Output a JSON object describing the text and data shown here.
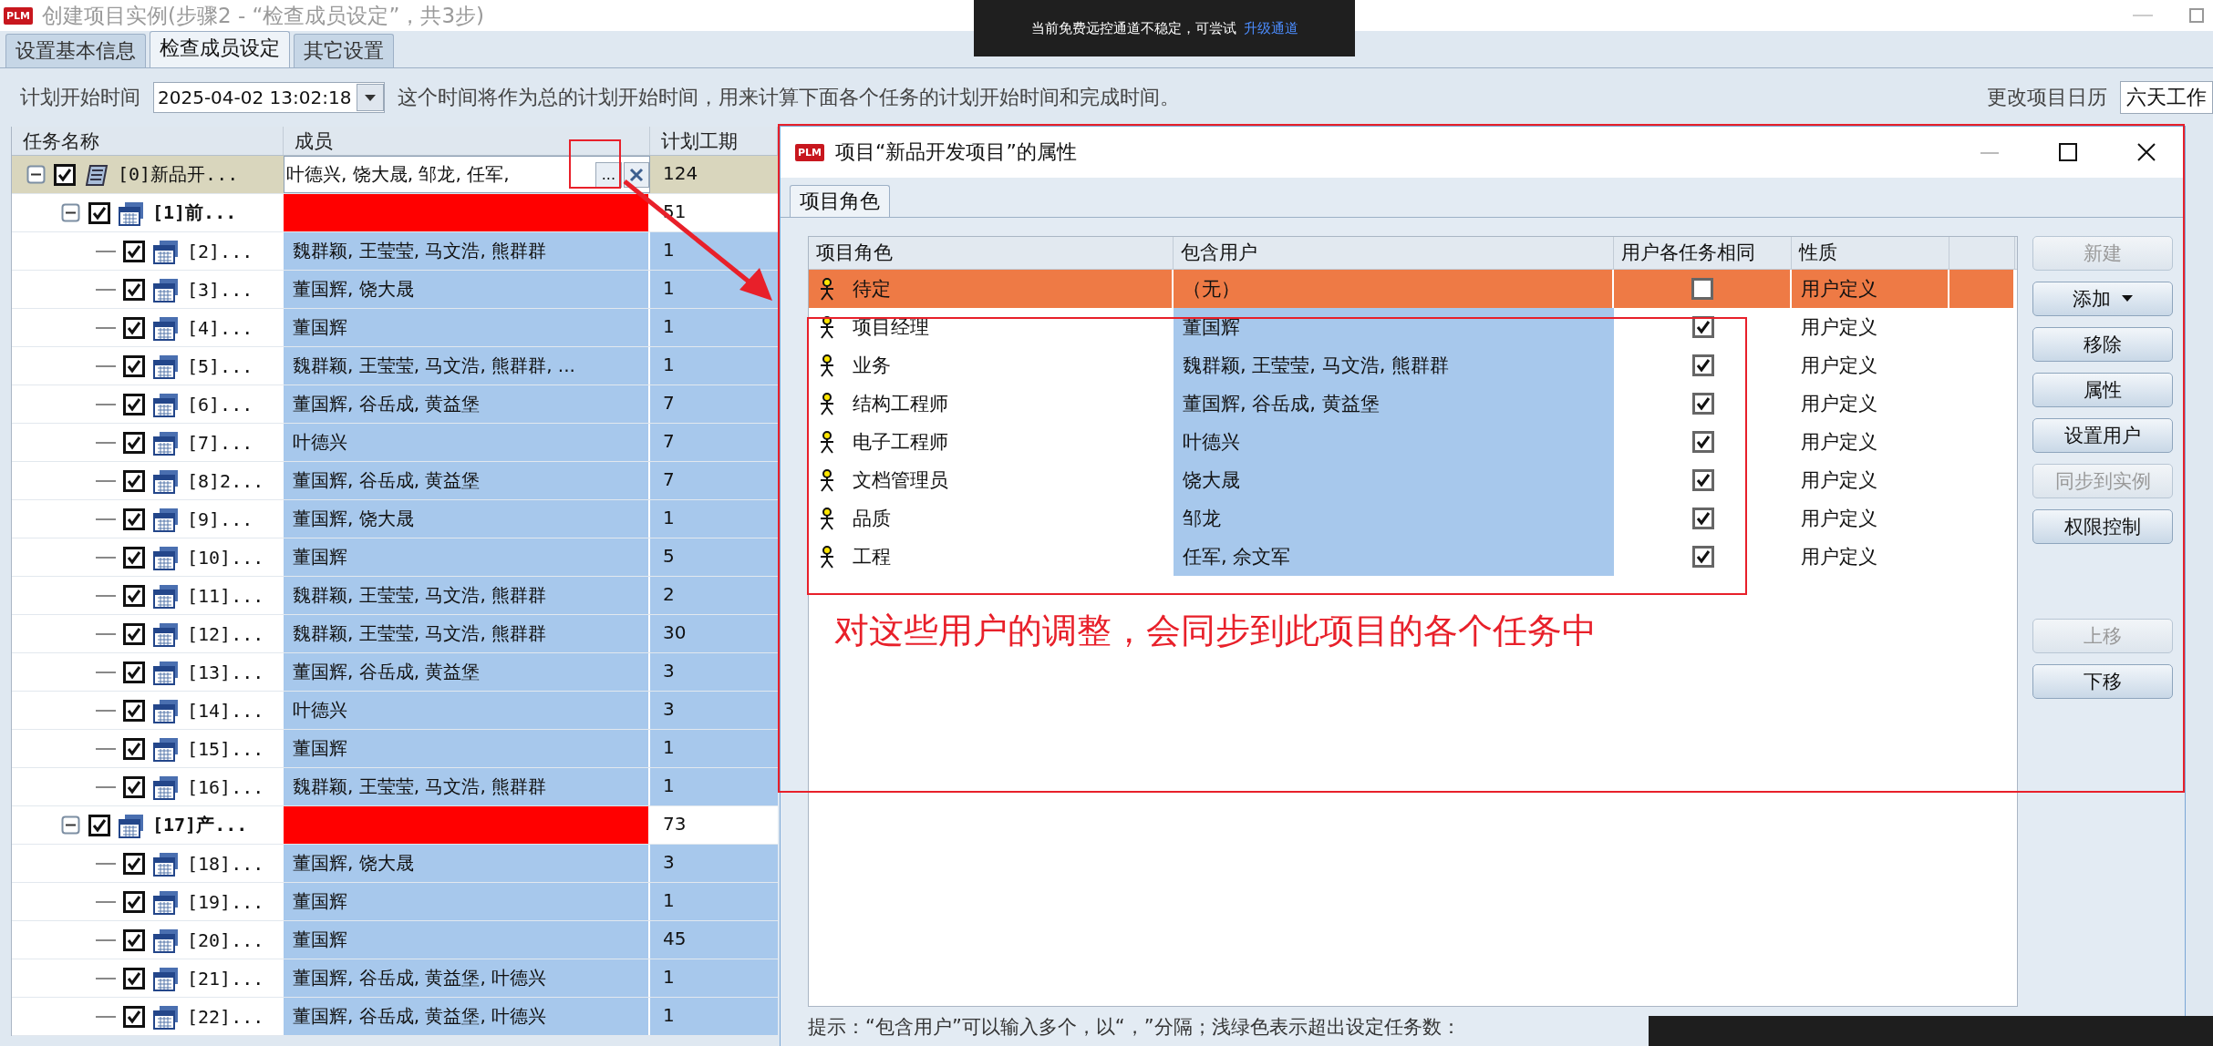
{
  "window": {
    "logo": "PLM",
    "title": "创建项目实例(步骤2 - “检查成员设定”，共3步)"
  },
  "notification": {
    "text": "当前免费远控通道不稳定，可尝试",
    "link": "升级通道"
  },
  "tabs": [
    {
      "label": "设置基本信息",
      "selected": false
    },
    {
      "label": "检查成员设定",
      "selected": true
    },
    {
      "label": "其它设置",
      "selected": false
    }
  ],
  "toolbar": {
    "start_label": "计划开始时间",
    "start_value": "2025-04-02 13:02:18",
    "note": "这个时间将作为总的计划开始时间，用来计算下面各个任务的计划开始时间和完成时间。",
    "calendar_label": "更改项目日历",
    "calendar_value": "六天工作"
  },
  "task_table": {
    "columns": [
      "任务名称",
      "成员",
      "计划工期"
    ],
    "browse_label": "...",
    "rows": [
      {
        "kind": "project",
        "name": "[0]新品开...",
        "members": "叶德兴, 饶大晟, 邹龙, 任军,",
        "duration": "124",
        "checked": true,
        "expanded": true,
        "selected": true,
        "flagged": false,
        "children": [
          {
            "kind": "phase",
            "name": "[1]前...",
            "duration": "51",
            "checked": true,
            "expanded": true,
            "selected": false,
            "flagged": true,
            "children": [
              {
                "kind": "task",
                "name": "[2]...",
                "members": "魏群颖, 王莹莹, 马文浩, 熊群群",
                "duration": "1",
                "checked": true,
                "selected": false,
                "flagged": false
              },
              {
                "kind": "task",
                "name": "[3]...",
                "members": "董国辉, 饶大晟",
                "duration": "1",
                "checked": true,
                "selected": false,
                "flagged": false
              },
              {
                "kind": "task",
                "name": "[4]...",
                "members": "董国辉",
                "duration": "1",
                "checked": true,
                "selected": false,
                "flagged": false
              },
              {
                "kind": "task",
                "name": "[5]...",
                "members": "魏群颖, 王莹莹, 马文浩, 熊群群, ...",
                "duration": "1",
                "checked": true,
                "selected": false,
                "flagged": false
              },
              {
                "kind": "task",
                "name": "[6]...",
                "members": "董国辉, 谷岳成, 黄益堡",
                "duration": "7",
                "checked": true,
                "selected": false,
                "flagged": false
              },
              {
                "kind": "task",
                "name": "[7]...",
                "members": "叶德兴",
                "duration": "7",
                "checked": true,
                "selected": false,
                "flagged": false
              },
              {
                "kind": "task",
                "name": "[8]2...",
                "members": "董国辉, 谷岳成, 黄益堡",
                "duration": "7",
                "checked": true,
                "selected": false,
                "flagged": false
              },
              {
                "kind": "task",
                "name": "[9]...",
                "members": "董国辉, 饶大晟",
                "duration": "1",
                "checked": true,
                "selected": false,
                "flagged": false
              },
              {
                "kind": "task",
                "name": "[10]...",
                "members": "董国辉",
                "duration": "5",
                "checked": true,
                "selected": false,
                "flagged": false
              },
              {
                "kind": "task",
                "name": "[11]...",
                "members": "魏群颖, 王莹莹, 马文浩, 熊群群",
                "duration": "2",
                "checked": true,
                "selected": false,
                "flagged": false
              },
              {
                "kind": "task",
                "name": "[12]...",
                "members": "魏群颖, 王莹莹, 马文浩, 熊群群",
                "duration": "30",
                "checked": true,
                "selected": false,
                "flagged": false
              },
              {
                "kind": "task",
                "name": "[13]...",
                "members": "董国辉, 谷岳成, 黄益堡",
                "duration": "3",
                "checked": true,
                "selected": false,
                "flagged": false
              },
              {
                "kind": "task",
                "name": "[14]...",
                "members": "叶德兴",
                "duration": "3",
                "checked": true,
                "selected": false,
                "flagged": false
              },
              {
                "kind": "task",
                "name": "[15]...",
                "members": "董国辉",
                "duration": "1",
                "checked": true,
                "selected": false,
                "flagged": false
              },
              {
                "kind": "task",
                "name": "[16]...",
                "members": "魏群颖, 王莹莹, 马文浩, 熊群群",
                "duration": "1",
                "checked": true,
                "selected": false,
                "flagged": false
              }
            ]
          },
          {
            "kind": "phase",
            "name": "[17]产...",
            "duration": "73",
            "checked": true,
            "expanded": true,
            "selected": false,
            "flagged": true,
            "children": [
              {
                "kind": "task",
                "name": "[18]...",
                "members": "董国辉, 饶大晟",
                "duration": "3",
                "checked": true,
                "selected": false,
                "flagged": false
              },
              {
                "kind": "task",
                "name": "[19]...",
                "members": "董国辉",
                "duration": "1",
                "checked": true,
                "selected": false,
                "flagged": false
              },
              {
                "kind": "task",
                "name": "[20]...",
                "members": "董国辉",
                "duration": "45",
                "checked": true,
                "selected": false,
                "flagged": false
              },
              {
                "kind": "task",
                "name": "[21]...",
                "members": "董国辉, 谷岳成, 黄益堡, 叶德兴",
                "duration": "1",
                "checked": true,
                "selected": false,
                "flagged": false
              },
              {
                "kind": "task",
                "name": "[22]...",
                "members": "董国辉, 谷岳成, 黄益堡, 叶德兴",
                "duration": "1",
                "checked": true,
                "selected": false,
                "flagged": false
              }
            ]
          }
        ]
      }
    ]
  },
  "dialog": {
    "logo": "PLM",
    "title": "项目“新品开发项目”的属性",
    "tab": "项目角色",
    "columns": [
      "项目角色",
      "包含用户",
      "用户各任务相同",
      "性质"
    ],
    "roles": [
      {
        "name": "待定",
        "users": "（无）",
        "same_for_all": false,
        "nature": "用户定义",
        "selected": true
      },
      {
        "name": "项目经理",
        "users": "董国辉",
        "same_for_all": true,
        "nature": "用户定义",
        "selected": false
      },
      {
        "name": "业务",
        "users": "魏群颖, 王莹莹, 马文浩, 熊群群",
        "same_for_all": true,
        "nature": "用户定义",
        "selected": false
      },
      {
        "name": "结构工程师",
        "users": "董国辉, 谷岳成, 黄益堡",
        "same_for_all": true,
        "nature": "用户定义",
        "selected": false
      },
      {
        "name": "电子工程师",
        "users": "叶德兴",
        "same_for_all": true,
        "nature": "用户定义",
        "selected": false
      },
      {
        "name": "文档管理员",
        "users": "饶大晟",
        "same_for_all": true,
        "nature": "用户定义",
        "selected": false
      },
      {
        "name": "品质",
        "users": "邹龙",
        "same_for_all": true,
        "nature": "用户定义",
        "selected": false
      },
      {
        "name": "工程",
        "users": "任军, 佘文军",
        "same_for_all": true,
        "nature": "用户定义",
        "selected": false
      }
    ],
    "buttons": [
      {
        "label": "新建",
        "disabled": true,
        "kind": "plain"
      },
      {
        "label": "添加",
        "disabled": false,
        "kind": "dropdown"
      },
      {
        "label": "移除",
        "disabled": false,
        "kind": "plain"
      },
      {
        "label": "属性",
        "disabled": false,
        "kind": "plain"
      },
      {
        "label": "设置用户",
        "disabled": false,
        "kind": "plain"
      },
      {
        "label": "同步到实例",
        "disabled": true,
        "kind": "plain"
      },
      {
        "label": "权限控制",
        "disabled": false,
        "kind": "plain"
      },
      {
        "label": "上移",
        "disabled": true,
        "kind": "spaced"
      },
      {
        "label": "下移",
        "disabled": false,
        "kind": "plain"
      }
    ],
    "hint": "提示：“包含用户”可以输入多个，以“，”分隔；浅绿色表示超出设定任务数："
  },
  "annotation": {
    "text": "对这些用户的调整，会同步到此项目的各个任务中"
  }
}
